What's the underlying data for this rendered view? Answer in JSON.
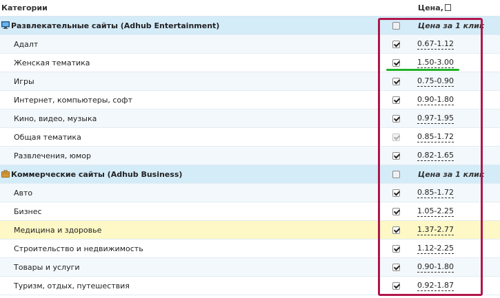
{
  "header": {
    "categories_label": "Категории",
    "price_label": "Цена,"
  },
  "groups": [
    {
      "title": "Развлекательные сайты (Adhub Entertainment)",
      "icon": "monitor-icon",
      "cpc_label": "Цена за 1 клик",
      "checked": false,
      "items": [
        {
          "name": "Адалт",
          "price": "0.67-1.12",
          "checked": true
        },
        {
          "name": "Женская тематика",
          "price": "1.50-3.00",
          "checked": true
        },
        {
          "name": "Игры",
          "price": "0.75-0.90",
          "checked": true
        },
        {
          "name": "Интернет, компьютеры, софт",
          "price": "0.90-1.80",
          "checked": true
        },
        {
          "name": "Кино, видео, музыка",
          "price": "0.97-1.95",
          "checked": true
        },
        {
          "name": "Общая тематика",
          "price": "0.85-1.72",
          "checked": true,
          "disabled": true
        },
        {
          "name": "Развлечения, юмор",
          "price": "0.82-1.65",
          "checked": true
        }
      ]
    },
    {
      "title": "Коммерческие сайты (Adhub Business)",
      "icon": "briefcase-icon",
      "cpc_label": "Цена за 1 клик",
      "checked": false,
      "items": [
        {
          "name": "Авто",
          "price": "0.85-1.72",
          "checked": true
        },
        {
          "name": "Бизнес",
          "price": "1.05-2.25",
          "checked": true
        },
        {
          "name": "Медицина и здоровье",
          "price": "1.37-2.77",
          "checked": true,
          "highlighted": true
        },
        {
          "name": "Строительство и недвижимость",
          "price": "1.12-2.25",
          "checked": true
        },
        {
          "name": "Товары и услуги",
          "price": "0.90-1.80",
          "checked": true
        },
        {
          "name": "Туризм, отдых, путешествия",
          "price": "0.92-1.87",
          "checked": true
        }
      ]
    }
  ],
  "colors": {
    "group_bg": "#d4ebf8",
    "row_bg": "#f3f8fc",
    "highlight_bg": "#fdf8c6",
    "annotation_box": "#b0154a",
    "annotation_underline": "#1db225"
  }
}
